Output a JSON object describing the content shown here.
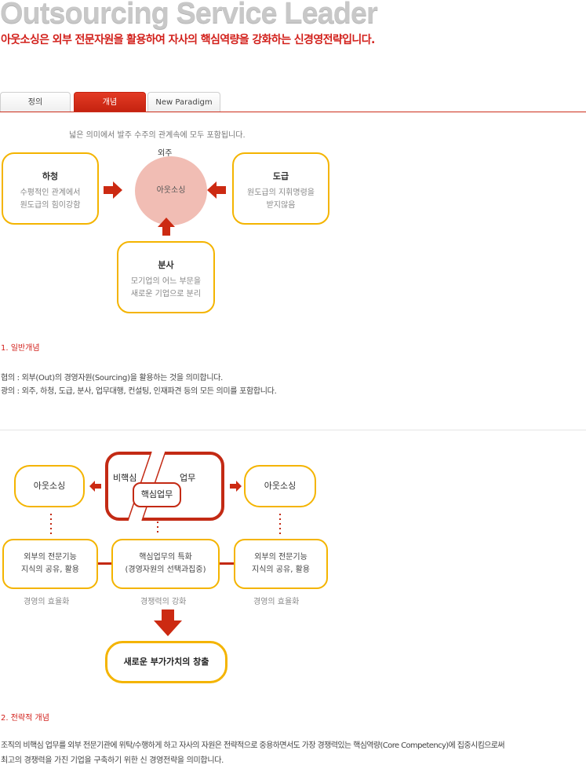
{
  "header": {
    "title": "Outsourcing Service Leader",
    "subtitle": "아웃소싱은 외부 전문자원을 활용하여 자사의 핵심역량을 강화하는 신경영전략입니다."
  },
  "tabs": [
    {
      "label": "정의",
      "active": false
    },
    {
      "label": "개념",
      "active": true
    },
    {
      "label": "New Paradigm",
      "active": false
    }
  ],
  "diagram1": {
    "note": "넓은 의미에서 발주 수주의 관계속에 모두 포함됩니다.",
    "center_top": "외주",
    "center": "아웃소싱",
    "left": {
      "title": "하청",
      "lines": [
        "수평적인 관계에서",
        "원도급의 힘이강함"
      ]
    },
    "right": {
      "title": "도급",
      "lines": [
        "원도급의 지휘명령을",
        "받지않음"
      ]
    },
    "bottom": {
      "title": "분사",
      "lines": [
        "모기업의 어느 부문을",
        "새로운 기업으로 분리"
      ]
    }
  },
  "section1": {
    "title": "1. 일반개념",
    "lines": [
      "협의 : 외부(Out)의 경영자원(Sourcing)을 활용하는 것을 의미합니다.",
      "광의 : 외주, 하청, 도급, 분사, 업무대행, 컨설팅, 인재파견 등의 모든 의미를 포함합니다."
    ]
  },
  "diagram2": {
    "left_oval": "아웃소싱",
    "right_oval": "아웃소싱",
    "center_a": "비핵심",
    "center_b": "업무",
    "center_core": "핵심업무",
    "boxes": [
      {
        "lines": [
          "외부의 전문기능",
          "지식의 공유, 활용"
        ],
        "caption": "경영의 효율화"
      },
      {
        "lines": [
          "핵심업무의 특화",
          "(경영자원의 선택과집중)"
        ],
        "caption": "경쟁력의 강화"
      },
      {
        "lines": [
          "외부의 전문기능",
          "지식의 공유, 활용"
        ],
        "caption": "경영의 효율화"
      }
    ],
    "final": "새로운 부가가치의 창출"
  },
  "section2": {
    "title": "2. 전략적 개념",
    "lines": [
      "조직의 비핵심 업무를 외부 전문기관에 위탁/수행하게 하고 자사의 자원은 전략적으로 중용하면서도 가장 경쟁력있는 핵심역량(Core Competency)에 집중시킴으로써",
      "최고의 경쟁력을 가진 기업을 구축하기 위한 신 경영전략을 의미합니다."
    ]
  },
  "colors": {
    "accent": "#d2201b",
    "box_border": "#f4b400",
    "circle": "#f1bdb4"
  }
}
